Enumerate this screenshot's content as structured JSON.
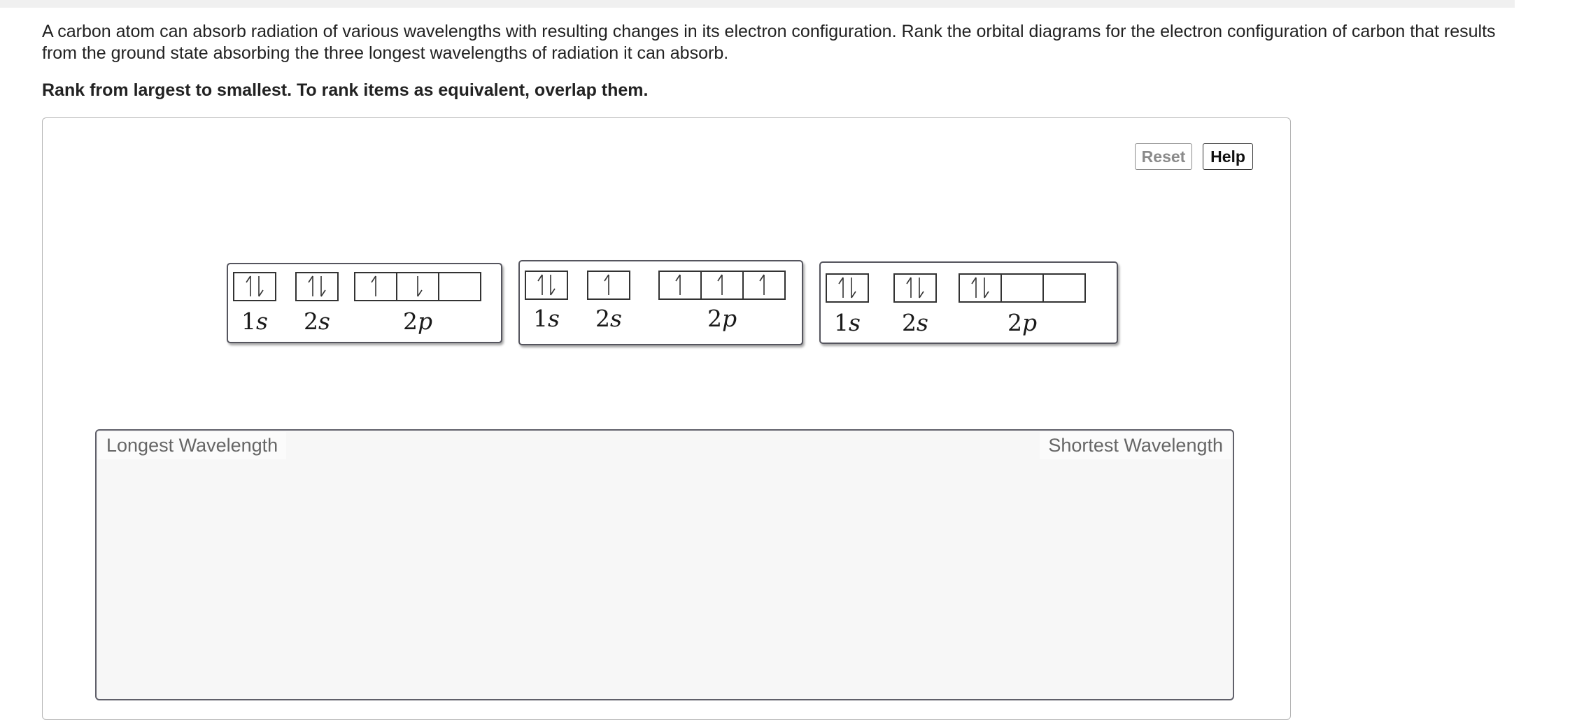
{
  "question": {
    "text": "A carbon atom can absorb radiation of various wavelengths with resulting changes in its electron configuration. Rank the orbital diagrams for the electron configuration of carbon that results from the ground state absorbing the three longest wavelengths of radiation it can absorb.",
    "instruction": "Rank from largest to smallest. To rank items as equivalent, overlap them."
  },
  "toolbar": {
    "reset_label": "Reset",
    "help_label": "Help"
  },
  "tiles": [
    {
      "id": "tile-a",
      "orbitals": [
        {
          "label_num": "1",
          "label_sub": "s",
          "boxes": [
            "updown"
          ]
        },
        {
          "label_num": "2",
          "label_sub": "s",
          "boxes": [
            "updown"
          ]
        },
        {
          "label_num": "2",
          "label_sub": "p",
          "boxes": [
            "up",
            "down",
            "empty"
          ]
        }
      ]
    },
    {
      "id": "tile-b",
      "orbitals": [
        {
          "label_num": "1",
          "label_sub": "s",
          "boxes": [
            "updown"
          ]
        },
        {
          "label_num": "2",
          "label_sub": "s",
          "boxes": [
            "up"
          ]
        },
        {
          "label_num": "2",
          "label_sub": "p",
          "boxes": [
            "up",
            "up",
            "up"
          ]
        }
      ]
    },
    {
      "id": "tile-c",
      "orbitals": [
        {
          "label_num": "1",
          "label_sub": "s",
          "boxes": [
            "updown"
          ]
        },
        {
          "label_num": "2",
          "label_sub": "s",
          "boxes": [
            "updown"
          ]
        },
        {
          "label_num": "2",
          "label_sub": "p",
          "boxes": [
            "updown",
            "empty",
            "empty"
          ]
        }
      ]
    }
  ],
  "dropzone": {
    "left_label": "Longest Wavelength",
    "right_label": "Shortest Wavelength"
  },
  "colors": {
    "tile_border": "#55555e",
    "zone_bg": "#f7f7f7",
    "reset_text": "#8a8a8a"
  }
}
